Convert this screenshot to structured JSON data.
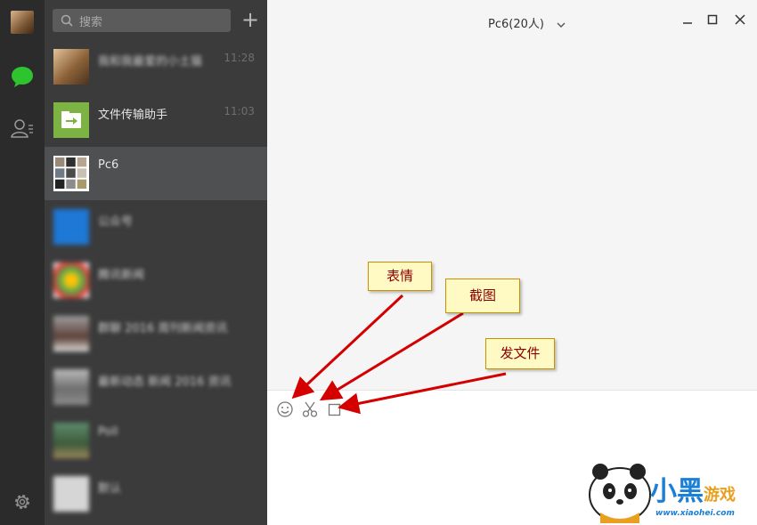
{
  "search": {
    "placeholder": "搜索"
  },
  "add_label": "+",
  "chats": [
    {
      "name": "我和我最爱的小土猫",
      "time": "11:28",
      "avatar": "cat-photo",
      "blurred": true
    },
    {
      "name": "文件传输助手",
      "time": "11:03",
      "avatar": "file-transfer-icon",
      "blurred": false
    },
    {
      "name": "Pc6",
      "time": "",
      "avatar": "group-grid",
      "blurred": false
    },
    {
      "name": "公众号",
      "time": "",
      "avatar": "blue-avatar",
      "blurred": true
    },
    {
      "name": "腾讯新闻",
      "time": "",
      "avatar": "colorful-avatar",
      "blurred": true
    },
    {
      "name": "群聊 2016 周刊新闻资讯",
      "time": "",
      "avatar": "photo-avatar",
      "blurred": true
    },
    {
      "name": "最新动态 新闻 2016 资讯",
      "time": "",
      "avatar": "photo-avatar-2",
      "blurred": true
    },
    {
      "name": "Poll",
      "time": "",
      "avatar": "landscape-avatar",
      "blurred": true
    },
    {
      "name": "默认",
      "time": "",
      "avatar": "default-avatar",
      "blurred": true
    }
  ],
  "conversation": {
    "title": "Pc6(20人)"
  },
  "toolbar": {
    "emoji": "smiley-icon",
    "screenshot": "scissors-icon",
    "file": "file-icon"
  },
  "callouts": {
    "emoji": "表情",
    "screenshot": "截图",
    "file": "发文件"
  },
  "watermark": {
    "site": "www.xiaohei.com",
    "logo_text": "小黑游戏"
  },
  "colors": {
    "rail": "#2b2b2b",
    "list": "#3b3b3c",
    "selected": "#4f5052",
    "chat_green": "#2ec42f",
    "callout_bg": "#fff9c4",
    "callout_text": "#8a0000",
    "arrow": "#d40000"
  }
}
